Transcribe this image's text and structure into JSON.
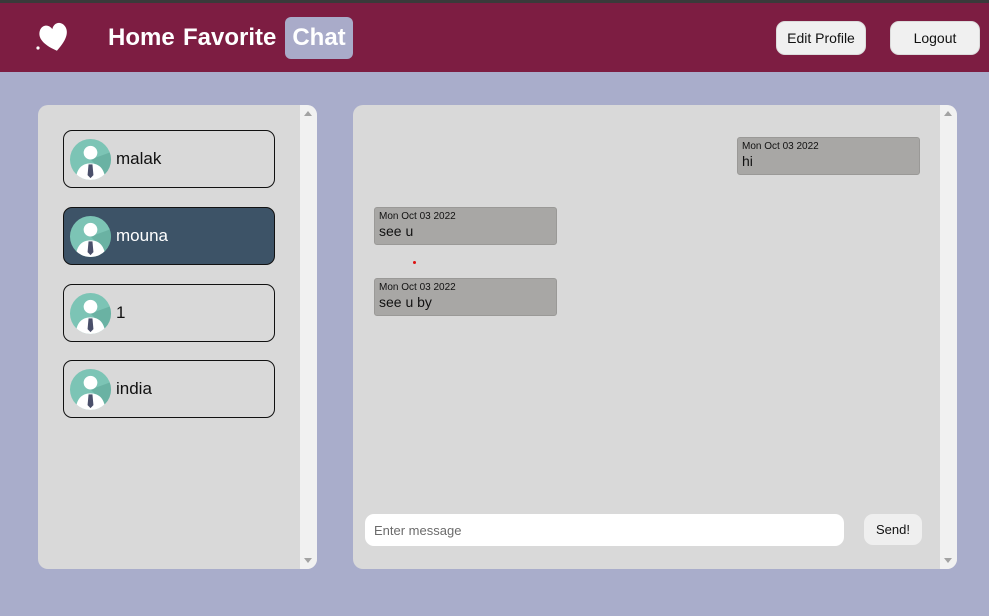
{
  "nav": {
    "home": "Home",
    "favorite": "Favorite",
    "chat": "Chat",
    "edit_profile": "Edit Profile",
    "logout": "Logout"
  },
  "contacts": [
    {
      "name": "malak",
      "active": false
    },
    {
      "name": "mouna",
      "active": true
    },
    {
      "name": "1",
      "active": false
    },
    {
      "name": "india",
      "active": false
    }
  ],
  "messages": [
    {
      "date": "Mon Oct 03 2022",
      "text": "hi",
      "side": "right"
    },
    {
      "date": "Mon Oct 03 2022",
      "text": "see u",
      "side": "left"
    },
    {
      "date": "Mon Oct 03 2022",
      "text": "see u by",
      "side": "left"
    }
  ],
  "composer": {
    "placeholder": "Enter message",
    "send_label": "Send!"
  },
  "colors": {
    "background": "#a9adcb",
    "navbar": "#7d1d42",
    "active_nav": "#a9abc9",
    "panel": "#d9d9d9",
    "active_contact": "#3d5367",
    "bubble": "#a8a7a5"
  },
  "icons": {
    "logo": "heart-logo-icon",
    "avatar": "user-avatar-icon"
  }
}
